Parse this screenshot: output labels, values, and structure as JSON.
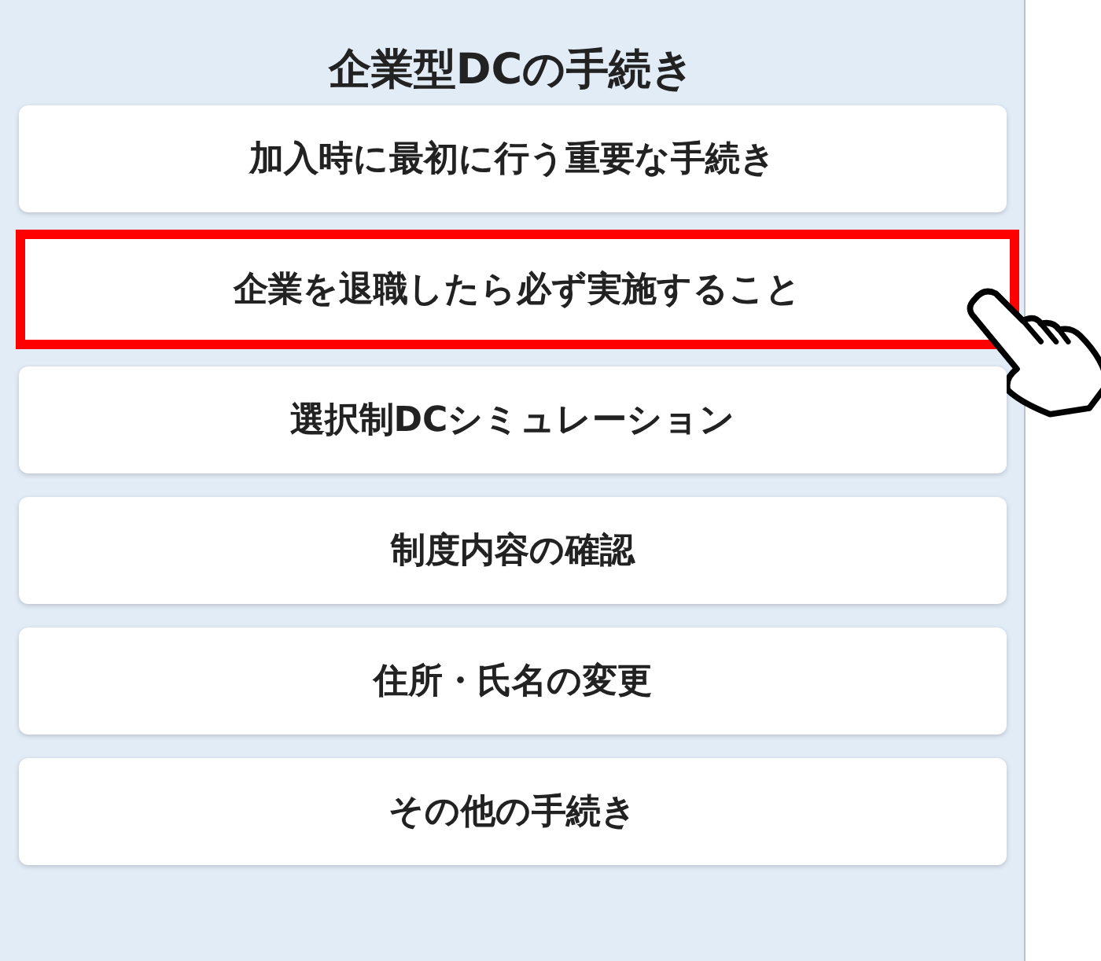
{
  "title": "企業型DCの手続き",
  "menu_items": [
    {
      "label": "加入時に最初に行う重要な手続き",
      "highlighted": false
    },
    {
      "label": "企業を退職したら必ず実施すること",
      "highlighted": true
    },
    {
      "label": "選択制DCシミュレーション",
      "highlighted": false
    },
    {
      "label": "制度内容の確認",
      "highlighted": false
    },
    {
      "label": "住所・氏名の変更",
      "highlighted": false
    },
    {
      "label": "その他の手続き",
      "highlighted": false
    }
  ]
}
